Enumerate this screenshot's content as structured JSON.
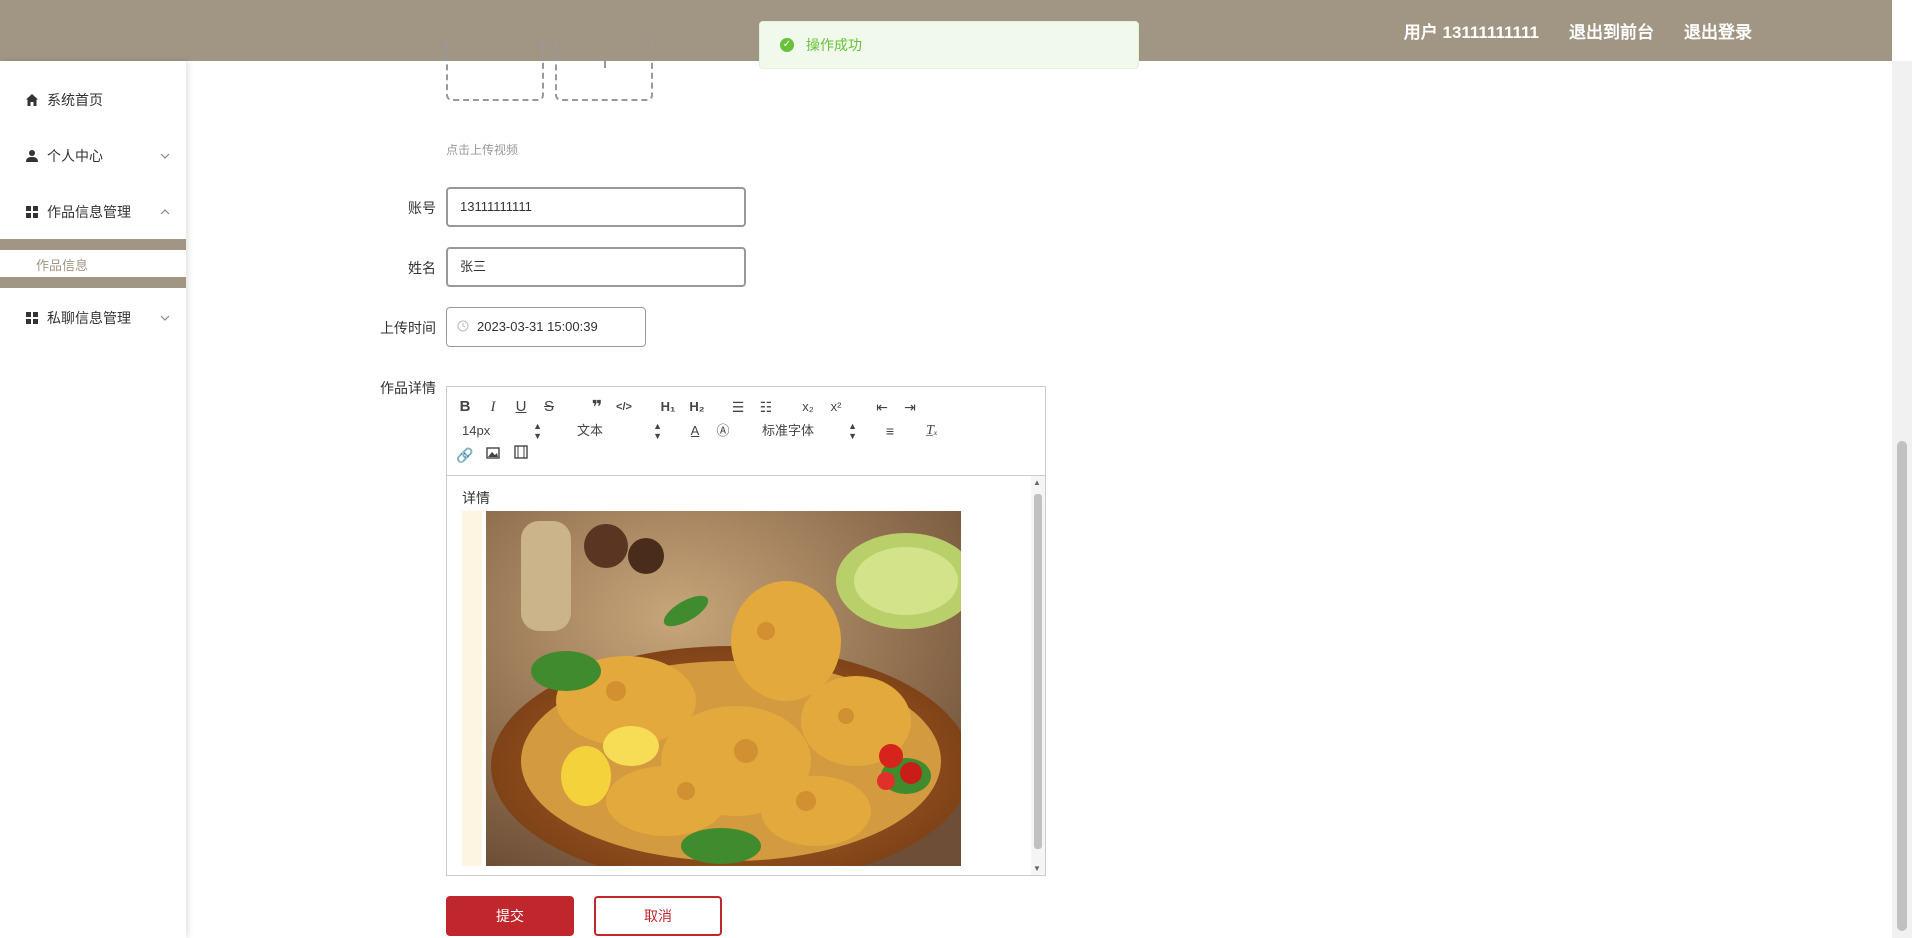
{
  "header": {
    "user_label": "用户 13111111111",
    "to_front_label": "退出到前台",
    "logout_label": "退出登录"
  },
  "toast": {
    "message": "操作成功"
  },
  "sidebar": {
    "items": [
      {
        "label": "系统首页",
        "icon": "home-icon"
      },
      {
        "label": "个人中心",
        "icon": "user-icon"
      },
      {
        "label": "作品信息管理",
        "icon": "grid-icon"
      },
      {
        "label": "私聊信息管理",
        "icon": "grid-icon"
      }
    ],
    "sub_items": [
      {
        "label": "作品信息"
      }
    ]
  },
  "form": {
    "upload_hint": "点击上传视频",
    "account": {
      "label": "账号",
      "value": "13111111111"
    },
    "name": {
      "label": "姓名",
      "value": "张三"
    },
    "upload_time": {
      "label": "上传时间",
      "value": "2023-03-31 15:00:39"
    },
    "detail": {
      "label": "作品详情"
    }
  },
  "editor": {
    "font_size": "14px",
    "header_select": "文本",
    "font_family": "标准字体",
    "content_text": "详情"
  },
  "buttons": {
    "submit": "提交",
    "cancel": "取消"
  },
  "colors": {
    "header_bg": "#a19584",
    "primary": "#c0272d",
    "success": "#67c23a"
  }
}
